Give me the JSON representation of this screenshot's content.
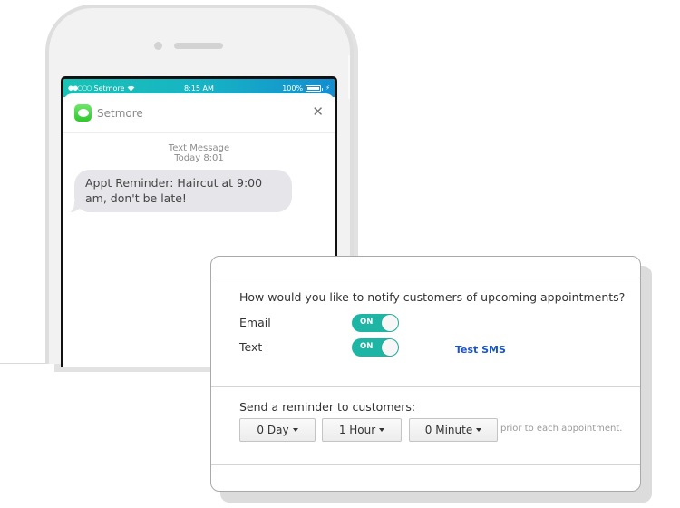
{
  "phone": {
    "status_bar": {
      "signal": "●●○○○",
      "carrier": "Setmore",
      "wifi_icon": "wifi-icon",
      "time": "8:15 AM",
      "battery_percent": "100%",
      "battery_level": 1.0
    },
    "notification": {
      "app_icon": "messages-icon",
      "app_name": "Setmore",
      "close_symbol": "✕",
      "message_type": "Text Message",
      "message_time": "Today 8:01",
      "message_text": "Appt Reminder: Haircut at 9:00 am, don't be late!"
    }
  },
  "settings": {
    "question": "How would you like to notify customers of upcoming appointments?",
    "channels": [
      {
        "label": "Email",
        "toggle_label": "ON",
        "enabled": true
      },
      {
        "label": "Text",
        "toggle_label": "ON",
        "enabled": true
      }
    ],
    "test_sms_label": "Test SMS",
    "reminder_label": "Send a reminder to customers:",
    "dropdowns": [
      {
        "value": "0 Day"
      },
      {
        "value": "1 Hour"
      },
      {
        "value": "0 Minute"
      }
    ],
    "prior_text": "prior to each appointment."
  },
  "colors": {
    "toggle_on": "#1fb5a5",
    "link": "#1a55c9",
    "status_bar_start": "#18c2b6",
    "status_bar_end": "#138dd0"
  }
}
